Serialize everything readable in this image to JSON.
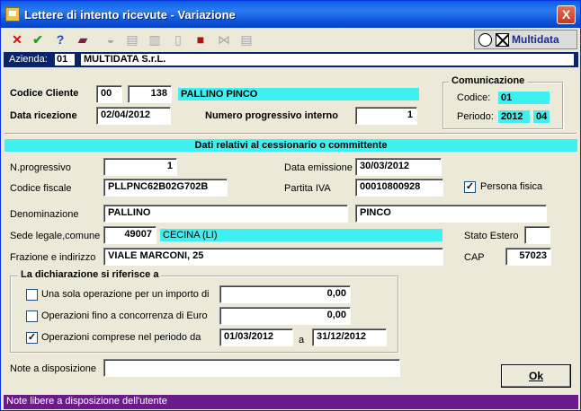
{
  "window": {
    "title": "Lettere di intento ricevute - Variazione",
    "close_glyph": "X"
  },
  "toolbar": {
    "icons": [
      "close-red-x-icon",
      "confirm-check-icon",
      "help-question-icon",
      "book-icon",
      "binoculars-icon",
      "print-icon",
      "print-preview-icon",
      "blank-page-icon",
      "red-stop-icon",
      "link-icon",
      "document-icon"
    ],
    "glyphs": {
      "close": "✕",
      "confirm": "✔",
      "help": "?",
      "book": "▰",
      "binoculars": "◒",
      "print": "▤",
      "preview": "▥",
      "page": "▯",
      "stop": "■",
      "link": "⋈",
      "doc": "▤"
    },
    "logo_text": "Multidata"
  },
  "azienda": {
    "label": "Azienda:",
    "code": "01",
    "name": "MULTIDATA S.r.L."
  },
  "header": {
    "codice_cliente_label": "Codice Cliente",
    "codice_cliente_1": "00",
    "codice_cliente_2": "138",
    "cliente_nome": "PALLINO PINCO",
    "data_ricezione_label": "Data ricezione",
    "data_ricezione": "02/04/2012",
    "numero_progressivo_label": "Numero progressivo interno",
    "numero_progressivo": "1"
  },
  "comunicazione": {
    "title": "Comunicazione",
    "codice_label": "Codice:",
    "codice": "01",
    "periodo_label": "Periodo:",
    "periodo_anno": "2012",
    "periodo_num": "04"
  },
  "section_title": "Dati relativi al cessionario o committente",
  "cessionario": {
    "n_progressivo_label": "N.progressivo",
    "n_progressivo": "1",
    "data_emissione_label": "Data emissione",
    "data_emissione": "30/03/2012",
    "codice_fiscale_label": "Codice fiscale",
    "codice_fiscale": "PLLPNC62B02G702B",
    "partita_iva_label": "Partita IVA",
    "partita_iva": "00010800928",
    "persona_fisica_label": "Persona fisica",
    "persona_fisica_checked": true,
    "denominazione_label": "Denominazione",
    "denominazione_1": "PALLINO",
    "denominazione_2": "PINCO",
    "sede_label": "Sede legale,comune",
    "sede_cod": "49007",
    "sede_comune": "CECINA (LI)",
    "stato_estero_label": "Stato Estero",
    "stato_estero": "",
    "indirizzo_label": "Frazione e indirizzo",
    "indirizzo": "VIALE MARCONI, 25",
    "cap_label": "CAP",
    "cap": "57023"
  },
  "dichiarazione": {
    "title": "La dichiarazione si riferisce a",
    "op1_label": "Una sola operazione per un importo di",
    "op1_checked": false,
    "op1_value": "0,00",
    "op2_label": "Operazioni fino a concorrenza di Euro",
    "op2_checked": false,
    "op2_value": "0,00",
    "op3_label": "Operazioni comprese nel periodo da",
    "op3_checked": true,
    "op3_from": "01/03/2012",
    "op3_a": "a",
    "op3_to": "31/12/2012"
  },
  "note": {
    "label": "Note a disposizione",
    "value": ""
  },
  "ok_button": "Ok",
  "check_glyph": "✓",
  "status": "Note libere a disposizione dell'utente"
}
